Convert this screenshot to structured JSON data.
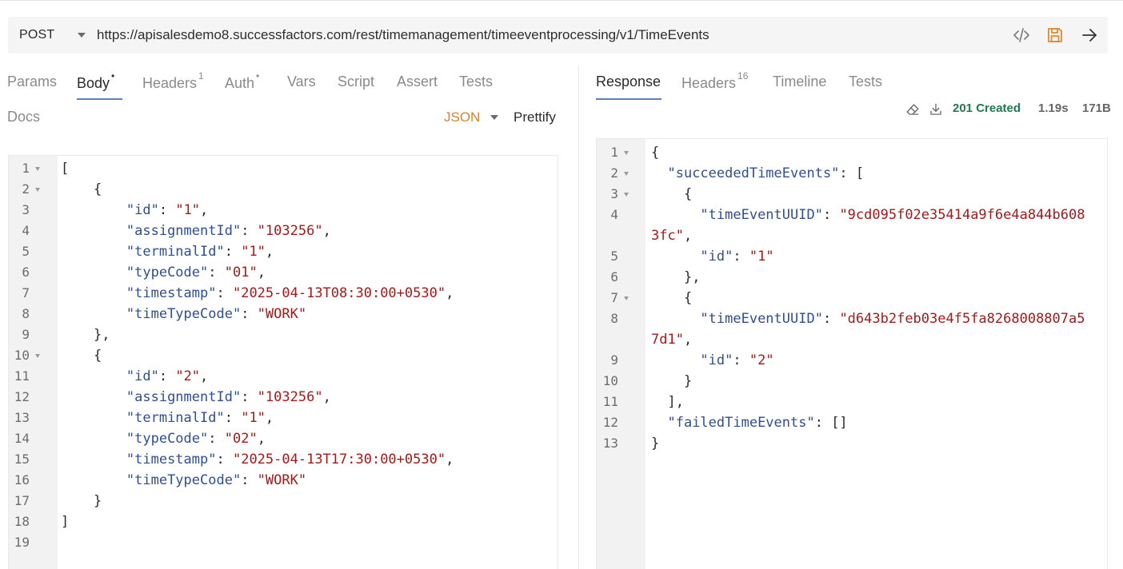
{
  "request": {
    "method": "POST",
    "url": "https://apisalesdemo8.successfactors.com/rest/timemanagement/timeeventprocessing/v1/TimeEvents"
  },
  "icons": {
    "code": "code-brackets-icon",
    "save": "save-disk-icon",
    "send": "arrow-right-icon",
    "clear": "eraser-icon",
    "download": "download-icon"
  },
  "colors": {
    "accent": "#5b7fc2",
    "save_icon": "#e0892f",
    "json_label": "#d9822b",
    "status_ok": "#1f7a50",
    "json_key": "#2f4f8f",
    "json_string": "#a31a1a"
  },
  "request_tabs": [
    {
      "label": "Params",
      "badge": ""
    },
    {
      "label": "Body",
      "badge": "•",
      "active": true
    },
    {
      "label": "Headers",
      "badge": "1"
    },
    {
      "label": "Auth",
      "badge": "•"
    },
    {
      "label": "Vars",
      "badge": ""
    },
    {
      "label": "Script",
      "badge": ""
    },
    {
      "label": "Assert",
      "badge": ""
    },
    {
      "label": "Tests",
      "badge": ""
    },
    {
      "label": "Docs",
      "badge": ""
    }
  ],
  "body_mode": "JSON",
  "prettify_label": "Prettify",
  "response_tabs": [
    {
      "label": "Response",
      "badge": "",
      "active": true
    },
    {
      "label": "Headers",
      "badge": "16"
    },
    {
      "label": "Timeline",
      "badge": ""
    },
    {
      "label": "Tests",
      "badge": ""
    }
  ],
  "response_meta": {
    "status": "201 Created",
    "time": "1.19s",
    "size": "171B"
  },
  "request_body": [
    {
      "n": "1",
      "fold": true,
      "indent": 0,
      "parts": [
        [
          "p",
          "["
        ]
      ]
    },
    {
      "n": "2",
      "fold": true,
      "indent": 4,
      "parts": [
        [
          "p",
          "{"
        ]
      ]
    },
    {
      "n": "3",
      "indent": 8,
      "parts": [
        [
          "k",
          "\"id\""
        ],
        [
          "p",
          ": "
        ],
        [
          "s",
          "\"1\""
        ],
        [
          "p",
          ","
        ]
      ]
    },
    {
      "n": "4",
      "indent": 8,
      "parts": [
        [
          "k",
          "\"assignmentId\""
        ],
        [
          "p",
          ": "
        ],
        [
          "s",
          "\"103256\""
        ],
        [
          "p",
          ","
        ]
      ]
    },
    {
      "n": "5",
      "indent": 8,
      "parts": [
        [
          "k",
          "\"terminalId\""
        ],
        [
          "p",
          ": "
        ],
        [
          "s",
          "\"1\""
        ],
        [
          "p",
          ","
        ]
      ]
    },
    {
      "n": "6",
      "indent": 8,
      "parts": [
        [
          "k",
          "\"typeCode\""
        ],
        [
          "p",
          ": "
        ],
        [
          "s",
          "\"01\""
        ],
        [
          "p",
          ","
        ]
      ]
    },
    {
      "n": "7",
      "indent": 8,
      "parts": [
        [
          "k",
          "\"timestamp\""
        ],
        [
          "p",
          ": "
        ],
        [
          "s",
          "\"2025-04-13T08:30:00+0530\""
        ],
        [
          "p",
          ","
        ]
      ]
    },
    {
      "n": "8",
      "indent": 8,
      "parts": [
        [
          "k",
          "\"timeTypeCode\""
        ],
        [
          "p",
          ": "
        ],
        [
          "s",
          "\"WORK\""
        ]
      ]
    },
    {
      "n": "9",
      "indent": 4,
      "parts": [
        [
          "p",
          "},"
        ]
      ]
    },
    {
      "n": "10",
      "fold": true,
      "indent": 4,
      "parts": [
        [
          "p",
          "{"
        ]
      ]
    },
    {
      "n": "11",
      "indent": 8,
      "parts": [
        [
          "k",
          "\"id\""
        ],
        [
          "p",
          ": "
        ],
        [
          "s",
          "\"2\""
        ],
        [
          "p",
          ","
        ]
      ]
    },
    {
      "n": "12",
      "indent": 8,
      "parts": [
        [
          "k",
          "\"assignmentId\""
        ],
        [
          "p",
          ": "
        ],
        [
          "s",
          "\"103256\""
        ],
        [
          "p",
          ","
        ]
      ]
    },
    {
      "n": "13",
      "indent": 8,
      "parts": [
        [
          "k",
          "\"terminalId\""
        ],
        [
          "p",
          ": "
        ],
        [
          "s",
          "\"1\""
        ],
        [
          "p",
          ","
        ]
      ]
    },
    {
      "n": "14",
      "indent": 8,
      "parts": [
        [
          "k",
          "\"typeCode\""
        ],
        [
          "p",
          ": "
        ],
        [
          "s",
          "\"02\""
        ],
        [
          "p",
          ","
        ]
      ]
    },
    {
      "n": "15",
      "indent": 8,
      "parts": [
        [
          "k",
          "\"timestamp\""
        ],
        [
          "p",
          ": "
        ],
        [
          "s",
          "\"2025-04-13T17:30:00+0530\""
        ],
        [
          "p",
          ","
        ]
      ]
    },
    {
      "n": "16",
      "indent": 8,
      "parts": [
        [
          "k",
          "\"timeTypeCode\""
        ],
        [
          "p",
          ": "
        ],
        [
          "s",
          "\"WORK\""
        ]
      ]
    },
    {
      "n": "17",
      "indent": 4,
      "parts": [
        [
          "p",
          "}"
        ]
      ]
    },
    {
      "n": "18",
      "indent": 0,
      "parts": [
        [
          "p",
          "]"
        ]
      ]
    },
    {
      "n": "19",
      "indent": 0,
      "parts": []
    }
  ],
  "response_body": [
    {
      "n": "1",
      "fold": true,
      "indent": 0,
      "parts": [
        [
          "p",
          "{"
        ]
      ]
    },
    {
      "n": "2",
      "fold": true,
      "indent": 2,
      "parts": [
        [
          "k",
          "\"succeededTimeEvents\""
        ],
        [
          "p",
          ": ["
        ]
      ]
    },
    {
      "n": "3",
      "fold": true,
      "indent": 4,
      "parts": [
        [
          "p",
          "{"
        ]
      ]
    },
    {
      "n": "4",
      "indent": 6,
      "parts": [
        [
          "k",
          "\"timeEventUUID\""
        ],
        [
          "p",
          ": "
        ],
        [
          "s",
          "\"9cd095f02e35414a9f6e4a844b608"
        ]
      ]
    },
    {
      "n": "",
      "indent": 0,
      "parts": [
        [
          "s",
          "3fc\""
        ],
        [
          "p",
          ","
        ]
      ]
    },
    {
      "n": "5",
      "indent": 6,
      "parts": [
        [
          "k",
          "\"id\""
        ],
        [
          "p",
          ": "
        ],
        [
          "s",
          "\"1\""
        ]
      ]
    },
    {
      "n": "6",
      "indent": 4,
      "parts": [
        [
          "p",
          "},"
        ]
      ]
    },
    {
      "n": "7",
      "fold": true,
      "indent": 4,
      "parts": [
        [
          "p",
          "{"
        ]
      ]
    },
    {
      "n": "8",
      "indent": 6,
      "parts": [
        [
          "k",
          "\"timeEventUUID\""
        ],
        [
          "p",
          ": "
        ],
        [
          "s",
          "\"d643b2feb03e4f5fa8268008807a5"
        ]
      ]
    },
    {
      "n": "",
      "indent": 0,
      "parts": [
        [
          "s",
          "7d1\""
        ],
        [
          "p",
          ","
        ]
      ]
    },
    {
      "n": "9",
      "indent": 6,
      "parts": [
        [
          "k",
          "\"id\""
        ],
        [
          "p",
          ": "
        ],
        [
          "s",
          "\"2\""
        ]
      ]
    },
    {
      "n": "10",
      "indent": 4,
      "parts": [
        [
          "p",
          "}"
        ]
      ]
    },
    {
      "n": "11",
      "indent": 2,
      "parts": [
        [
          "p",
          "],"
        ]
      ]
    },
    {
      "n": "12",
      "indent": 2,
      "parts": [
        [
          "k",
          "\"failedTimeEvents\""
        ],
        [
          "p",
          ": []"
        ]
      ]
    },
    {
      "n": "13",
      "indent": 0,
      "parts": [
        [
          "p",
          "}"
        ]
      ]
    }
  ]
}
